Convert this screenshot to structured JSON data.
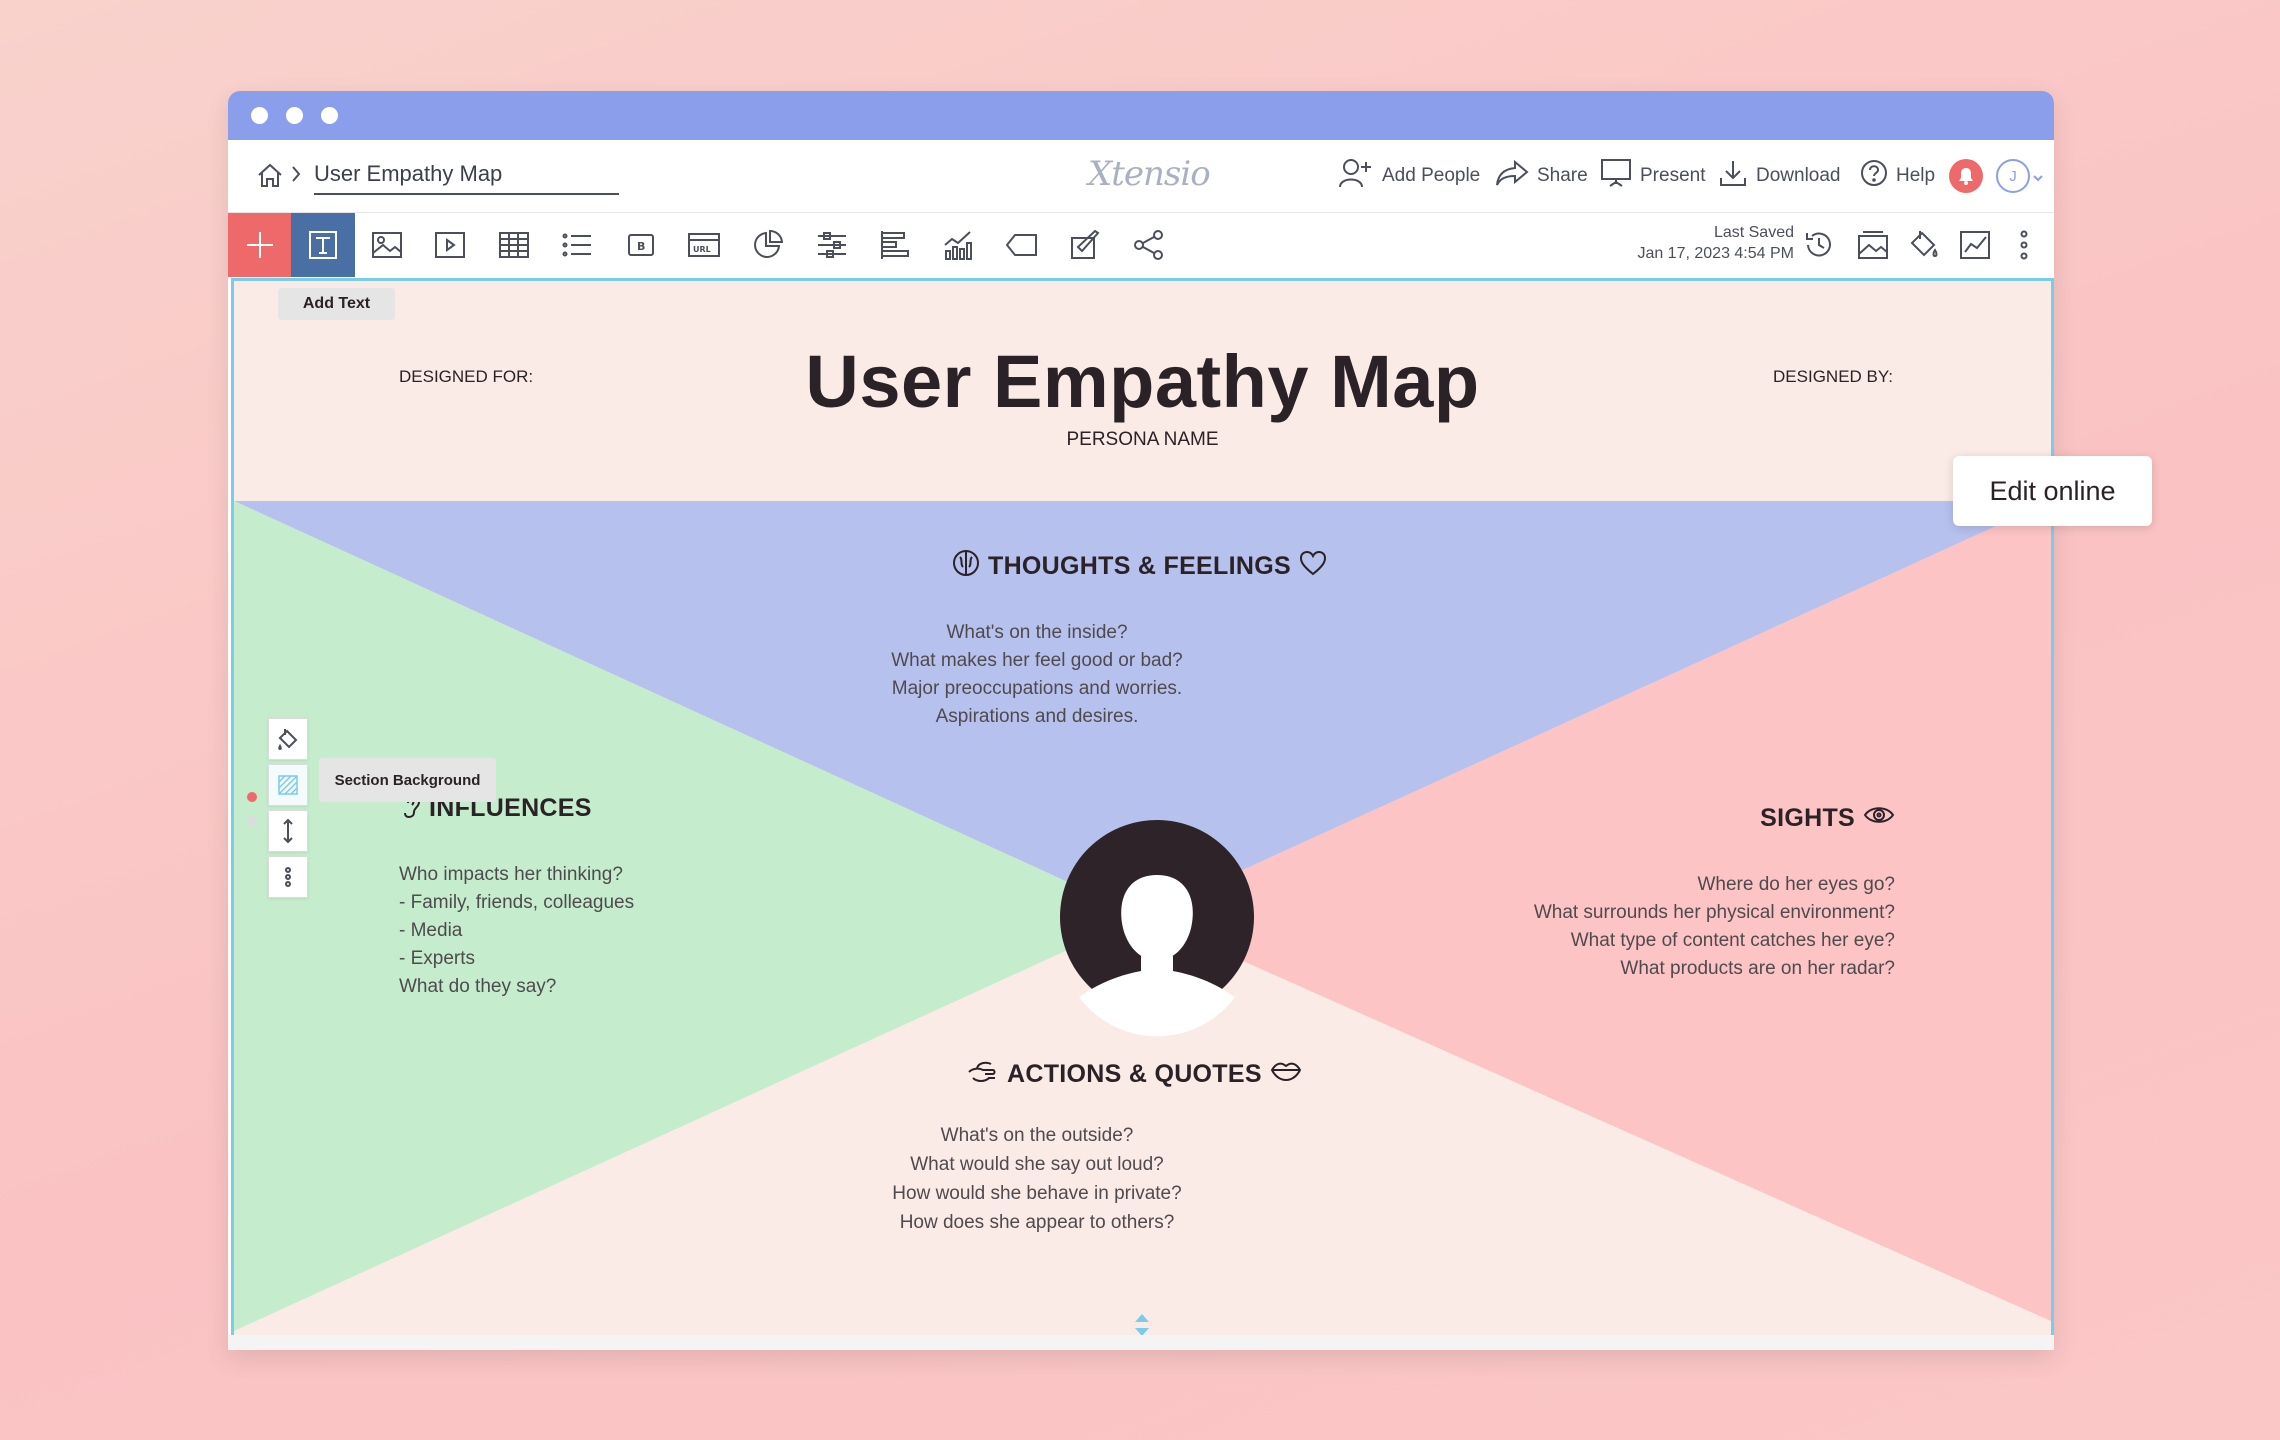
{
  "window": {
    "dots": 3
  },
  "header": {
    "breadcrumb_title": "User Empathy Map",
    "logo": "Xtensio",
    "actions": [
      {
        "label": "Add People",
        "icon": "add-person-icon"
      },
      {
        "label": "Share",
        "icon": "share-icon"
      },
      {
        "label": "Present",
        "icon": "present-icon"
      },
      {
        "label": "Download",
        "icon": "download-icon"
      },
      {
        "label": "Help",
        "icon": "help-icon"
      }
    ],
    "avatar_initial": "J"
  },
  "toolbar": {
    "add_text_tooltip": "Add Text",
    "last_saved_label": "Last Saved",
    "last_saved_date": "Jan 17, 2023 4:54 PM",
    "tools": [
      "add-icon",
      "text-icon",
      "image-icon",
      "video-icon",
      "table-icon",
      "list-icon",
      "button-icon",
      "url-icon",
      "pie-chart-icon",
      "sliders-icon",
      "bar-chart-icon",
      "line-chart-icon",
      "tag-icon",
      "edit-icon",
      "social-icon"
    ],
    "right_tools": [
      "history-icon",
      "background-image-icon",
      "paint-icon",
      "analytics-icon",
      "more-icon"
    ]
  },
  "canvas": {
    "designed_for": "DESIGNED FOR:",
    "designed_by": "DESIGNED BY:",
    "title": "User Empathy Map",
    "persona_name": "PERSONA NAME",
    "edit_online": "Edit online",
    "section_background_tooltip": "Section Background",
    "colors": {
      "top": "#b7c1ee",
      "left": "#c5edcd",
      "right": "#fcc4c5",
      "bottom": "#faebe6",
      "avatar": "#2d2328"
    },
    "thoughts": {
      "title": "THOUGHTS & FEELINGS",
      "lines": [
        "What's on the inside?",
        "What makes her feel good or bad?",
        "Major preoccupations and worries.",
        "Aspirations and desires."
      ]
    },
    "influences": {
      "title": "INFLUENCES",
      "lines": [
        "Who impacts her thinking?",
        "- Family, friends, colleagues",
        "- Media",
        "- Experts",
        "What do they say?"
      ]
    },
    "sights": {
      "title": "SIGHTS",
      "lines": [
        "Where do her eyes go?",
        "What surrounds her physical environment?",
        "What type of content catches her eye?",
        "What products are on her radar?"
      ]
    },
    "actions": {
      "title": "ACTIONS & QUOTES",
      "lines": [
        "What's on the outside?",
        "What would she say out loud?",
        "How would she behave in private?",
        "How does she appear to others?"
      ]
    }
  }
}
